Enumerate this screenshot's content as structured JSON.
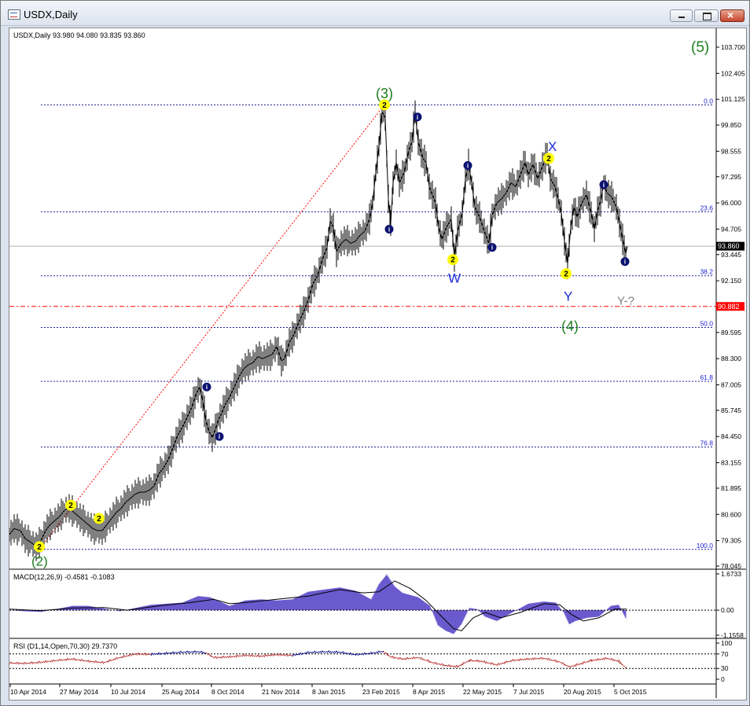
{
  "window": {
    "title": "USDX,Daily"
  },
  "chart_data": {
    "type": "line",
    "symbol": "USDX,Daily",
    "header_text": "USDX,Daily  93.980 94.080 93.835 93.860",
    "main_panel": {
      "y_ticks": [
        "103.700",
        "102.405",
        "101.125",
        "99.850",
        "98.555",
        "97.295",
        "96.000",
        "94.705",
        "93.445",
        "92.150",
        "90.882",
        "89.595",
        "88.300",
        "87.005",
        "85.745",
        "84.450",
        "83.155",
        "81.895",
        "80.600",
        "79.305",
        "78.045"
      ],
      "ylim": [
        78.045,
        103.7
      ],
      "last_price": "93.860",
      "dashdot_level": "90.882",
      "fib_levels": [
        {
          "label": "0.0",
          "price": 100.85
        },
        {
          "label": "23.6",
          "price": 95.56
        },
        {
          "label": "38.2",
          "price": 92.4
        },
        {
          "label": "50.0",
          "price": 89.84
        },
        {
          "label": "61.8",
          "price": 87.18
        },
        {
          "label": "76.8",
          "price": 83.93
        },
        {
          "label": "100.0",
          "price": 78.87
        }
      ],
      "x_dates": [
        "10 Apr 2014",
        "27 May 2014",
        "10 Jul 2014",
        "25 Aug 2014",
        "8 Oct 2014",
        "21 Nov 2014",
        "8 Jan 2015",
        "23 Feb 2015",
        "8 Apr 2015",
        "22 May 2015",
        "7 Jul 2015",
        "20 Aug 2015",
        "5 Oct 2015"
      ],
      "price_path": [
        [
          0,
          79.6
        ],
        [
          6,
          79.9
        ],
        [
          14,
          79.8
        ],
        [
          20,
          79.4
        ],
        [
          28,
          79.2
        ],
        [
          34,
          79.0
        ],
        [
          40,
          79.3
        ],
        [
          46,
          79.8
        ],
        [
          52,
          80.1
        ],
        [
          58,
          80.3
        ],
        [
          64,
          80.5
        ],
        [
          70,
          80.8
        ],
        [
          76,
          80.9
        ],
        [
          82,
          80.7
        ],
        [
          88,
          80.5
        ],
        [
          94,
          80.3
        ],
        [
          100,
          80.1
        ],
        [
          106,
          79.9
        ],
        [
          112,
          79.8
        ],
        [
          118,
          79.8
        ],
        [
          124,
          80.1
        ],
        [
          130,
          80.4
        ],
        [
          136,
          80.7
        ],
        [
          142,
          80.9
        ],
        [
          148,
          81.2
        ],
        [
          154,
          81.4
        ],
        [
          160,
          81.6
        ],
        [
          166,
          81.7
        ],
        [
          172,
          81.7
        ],
        [
          178,
          81.8
        ],
        [
          184,
          82.0
        ],
        [
          190,
          82.6
        ],
        [
          196,
          82.9
        ],
        [
          202,
          83.3
        ],
        [
          208,
          83.9
        ],
        [
          214,
          84.5
        ],
        [
          220,
          84.9
        ],
        [
          226,
          85.4
        ],
        [
          232,
          85.9
        ],
        [
          238,
          86.6
        ],
        [
          242,
          86.9
        ],
        [
          246,
          86.2
        ],
        [
          250,
          85.2
        ],
        [
          254,
          84.7
        ],
        [
          258,
          84.4
        ],
        [
          262,
          84.8
        ],
        [
          266,
          85.3
        ],
        [
          270,
          85.6
        ],
        [
          274,
          86.0
        ],
        [
          280,
          86.4
        ],
        [
          286,
          86.9
        ],
        [
          292,
          87.4
        ],
        [
          298,
          87.8
        ],
        [
          304,
          88.0
        ],
        [
          310,
          88.1
        ],
        [
          316,
          88.4
        ],
        [
          322,
          88.3
        ],
        [
          328,
          88.4
        ],
        [
          334,
          88.5
        ],
        [
          340,
          88.9
        ],
        [
          346,
          88.2
        ],
        [
          350,
          88.3
        ],
        [
          356,
          89.1
        ],
        [
          362,
          89.5
        ],
        [
          368,
          90.1
        ],
        [
          374,
          90.6
        ],
        [
          380,
          91.2
        ],
        [
          386,
          92.0
        ],
        [
          392,
          92.4
        ],
        [
          398,
          93.2
        ],
        [
          404,
          93.8
        ],
        [
          408,
          95.1
        ],
        [
          412,
          94.8
        ],
        [
          416,
          93.6
        ],
        [
          422,
          94.0
        ],
        [
          428,
          94.2
        ],
        [
          434,
          94.0
        ],
        [
          440,
          94.1
        ],
        [
          446,
          94.4
        ],
        [
          452,
          94.6
        ],
        [
          458,
          95.2
        ],
        [
          462,
          96.0
        ],
        [
          466,
          97.5
        ],
        [
          470,
          98.8
        ],
        [
          474,
          100.5
        ],
        [
          478,
          100.2
        ],
        [
          482,
          96.2
        ],
        [
          485,
          95.0
        ],
        [
          488,
          97.0
        ],
        [
          492,
          98.0
        ],
        [
          496,
          97.0
        ],
        [
          502,
          97.5
        ],
        [
          508,
          98.6
        ],
        [
          512,
          99.0
        ],
        [
          516,
          100.5
        ],
        [
          520,
          99.0
        ],
        [
          526,
          98.2
        ],
        [
          530,
          98.0
        ],
        [
          534,
          96.8
        ],
        [
          538,
          96.4
        ],
        [
          542,
          96.0
        ],
        [
          546,
          94.8
        ],
        [
          550,
          94.2
        ],
        [
          556,
          94.8
        ],
        [
          562,
          95.2
        ],
        [
          566,
          93.3
        ],
        [
          570,
          94.6
        ],
        [
          576,
          95.5
        ],
        [
          580,
          97.2
        ],
        [
          584,
          97.9
        ],
        [
          588,
          97.0
        ],
        [
          592,
          95.8
        ],
        [
          598,
          95.3
        ],
        [
          604,
          94.6
        ],
        [
          610,
          94.0
        ],
        [
          614,
          95.4
        ],
        [
          620,
          96.0
        ],
        [
          626,
          96.2
        ],
        [
          632,
          96.5
        ],
        [
          638,
          97.0
        ],
        [
          644,
          96.8
        ],
        [
          650,
          97.4
        ],
        [
          656,
          98.0
        ],
        [
          660,
          97.4
        ],
        [
          666,
          97.9
        ],
        [
          672,
          97.2
        ],
        [
          678,
          97.8
        ],
        [
          684,
          98.4
        ],
        [
          688,
          97.2
        ],
        [
          694,
          96.8
        ],
        [
          698,
          96.2
        ],
        [
          702,
          95.5
        ],
        [
          706,
          94.1
        ],
        [
          710,
          93.0
        ],
        [
          714,
          94.8
        ],
        [
          718,
          95.8
        ],
        [
          722,
          95.3
        ],
        [
          728,
          96.0
        ],
        [
          734,
          96.4
        ],
        [
          740,
          95.5
        ],
        [
          744,
          94.7
        ],
        [
          748,
          95.6
        ],
        [
          752,
          96.1
        ],
        [
          756,
          97.0
        ],
        [
          760,
          96.5
        ],
        [
          766,
          96.3
        ],
        [
          772,
          95.8
        ],
        [
          776,
          95.0
        ],
        [
          780,
          94.2
        ],
        [
          784,
          93.5
        ],
        [
          786,
          93.86
        ]
      ],
      "annotations": [
        {
          "text": "(5)",
          "price": 103.7,
          "x": 867
        },
        {
          "text": "(3)",
          "price": 101.4,
          "x": 466
        },
        {
          "text": "(2)",
          "price": 78.3,
          "x": 28
        },
        {
          "text": "(4)",
          "price": 89.9,
          "x": 702
        },
        {
          "text": "X",
          "price": 98.8,
          "x": 685
        },
        {
          "text": "W",
          "price": 92.3,
          "x": 558
        },
        {
          "text": "Y",
          "price": 91.4,
          "x": 705
        },
        {
          "text": "Y-?",
          "price": 91.2,
          "x": 773
        }
      ],
      "yellow_markers": [
        {
          "label": "2",
          "x": 38,
          "price": 79.0
        },
        {
          "label": "2",
          "x": 78,
          "price": 81.05
        },
        {
          "label": "2",
          "x": 114,
          "price": 80.4
        },
        {
          "label": "2",
          "x": 477,
          "price": 100.85
        },
        {
          "label": "2",
          "x": 564,
          "price": 93.2
        },
        {
          "label": "2",
          "x": 686,
          "price": 98.2
        },
        {
          "label": "2",
          "x": 708,
          "price": 92.5
        }
      ],
      "blue_markers": [
        {
          "label": "i",
          "x": 251,
          "price": 86.9
        },
        {
          "label": "i",
          "x": 267,
          "price": 84.45
        },
        {
          "label": "i",
          "x": 483,
          "price": 94.7
        },
        {
          "label": "i",
          "x": 519,
          "price": 100.25
        },
        {
          "label": "i",
          "x": 583,
          "price": 97.85
        },
        {
          "label": "i",
          "x": 614,
          "price": 93.8
        },
        {
          "label": "i",
          "x": 756,
          "price": 96.9
        },
        {
          "label": "i",
          "x": 783,
          "price": 93.1
        }
      ]
    },
    "macd_panel": {
      "label": "MACD(12,26,9) -0.4581 -0.1083",
      "y_ticks": [
        "1.6733",
        "0.00",
        "-1.1558"
      ],
      "ylim": [
        -1.1558,
        1.6733
      ],
      "histogram": [
        [
          0,
          0.0
        ],
        [
          20,
          -0.05
        ],
        [
          40,
          -0.08
        ],
        [
          60,
          0.05
        ],
        [
          80,
          0.2
        ],
        [
          100,
          0.2
        ],
        [
          120,
          0.08
        ],
        [
          140,
          -0.05
        ],
        [
          160,
          0.1
        ],
        [
          180,
          0.25
        ],
        [
          200,
          0.3
        ],
        [
          220,
          0.35
        ],
        [
          240,
          0.65
        ],
        [
          255,
          0.6
        ],
        [
          265,
          0.45
        ],
        [
          280,
          0.2
        ],
        [
          300,
          0.45
        ],
        [
          320,
          0.5
        ],
        [
          340,
          0.45
        ],
        [
          360,
          0.5
        ],
        [
          380,
          0.85
        ],
        [
          400,
          0.95
        ],
        [
          420,
          1.05
        ],
        [
          440,
          0.9
        ],
        [
          460,
          0.5
        ],
        [
          470,
          1.2
        ],
        [
          480,
          1.65
        ],
        [
          490,
          1.1
        ],
        [
          500,
          0.8
        ],
        [
          520,
          0.6
        ],
        [
          535,
          0.2
        ],
        [
          545,
          -0.7
        ],
        [
          555,
          -0.95
        ],
        [
          565,
          -1.1
        ],
        [
          575,
          -0.65
        ],
        [
          585,
          0.1
        ],
        [
          595,
          0.05
        ],
        [
          605,
          -0.3
        ],
        [
          620,
          -0.5
        ],
        [
          640,
          -0.1
        ],
        [
          660,
          0.3
        ],
        [
          680,
          0.4
        ],
        [
          695,
          0.35
        ],
        [
          705,
          -0.1
        ],
        [
          712,
          -0.65
        ],
        [
          720,
          -0.5
        ],
        [
          735,
          -0.35
        ],
        [
          750,
          -0.3
        ],
        [
          765,
          0.2
        ],
        [
          775,
          0.25
        ],
        [
          785,
          -0.45
        ]
      ],
      "signal": [
        [
          0,
          0.05
        ],
        [
          40,
          -0.02
        ],
        [
          80,
          0.1
        ],
        [
          120,
          0.12
        ],
        [
          150,
          0.0
        ],
        [
          190,
          0.2
        ],
        [
          230,
          0.35
        ],
        [
          260,
          0.5
        ],
        [
          280,
          0.3
        ],
        [
          300,
          0.35
        ],
        [
          340,
          0.5
        ],
        [
          380,
          0.65
        ],
        [
          420,
          0.95
        ],
        [
          450,
          0.8
        ],
        [
          470,
          0.85
        ],
        [
          490,
          1.35
        ],
        [
          510,
          1.0
        ],
        [
          530,
          0.45
        ],
        [
          550,
          -0.3
        ],
        [
          565,
          -0.85
        ],
        [
          575,
          -0.95
        ],
        [
          590,
          -0.35
        ],
        [
          605,
          -0.1
        ],
        [
          625,
          -0.35
        ],
        [
          650,
          -0.1
        ],
        [
          680,
          0.3
        ],
        [
          700,
          0.25
        ],
        [
          715,
          -0.2
        ],
        [
          730,
          -0.5
        ],
        [
          750,
          -0.35
        ],
        [
          770,
          0.05
        ],
        [
          785,
          0.05
        ]
      ]
    },
    "rsi_panel": {
      "label": "RSI (D1,14,Open,70,30) 29.7370",
      "y_ticks": [
        "100",
        "70",
        "30",
        "0"
      ],
      "ylim": [
        0,
        100
      ],
      "levels": [
        70,
        30
      ],
      "values": [
        [
          0,
          45
        ],
        [
          20,
          44
        ],
        [
          40,
          47
        ],
        [
          60,
          52
        ],
        [
          80,
          56
        ],
        [
          100,
          50
        ],
        [
          120,
          46
        ],
        [
          140,
          60
        ],
        [
          160,
          70
        ],
        [
          180,
          69
        ],
        [
          200,
          72
        ],
        [
          220,
          75
        ],
        [
          240,
          76
        ],
        [
          250,
          73
        ],
        [
          260,
          60
        ],
        [
          280,
          62
        ],
        [
          300,
          66
        ],
        [
          320,
          64
        ],
        [
          340,
          68
        ],
        [
          360,
          66
        ],
        [
          380,
          74
        ],
        [
          400,
          76
        ],
        [
          420,
          75
        ],
        [
          440,
          68
        ],
        [
          460,
          72
        ],
        [
          475,
          77
        ],
        [
          485,
          62
        ],
        [
          500,
          56
        ],
        [
          520,
          60
        ],
        [
          540,
          45
        ],
        [
          555,
          38
        ],
        [
          570,
          35
        ],
        [
          585,
          52
        ],
        [
          600,
          50
        ],
        [
          620,
          40
        ],
        [
          640,
          52
        ],
        [
          660,
          56
        ],
        [
          680,
          58
        ],
        [
          700,
          48
        ],
        [
          712,
          34
        ],
        [
          725,
          42
        ],
        [
          740,
          52
        ],
        [
          760,
          58
        ],
        [
          775,
          50
        ],
        [
          785,
          30
        ]
      ]
    }
  }
}
